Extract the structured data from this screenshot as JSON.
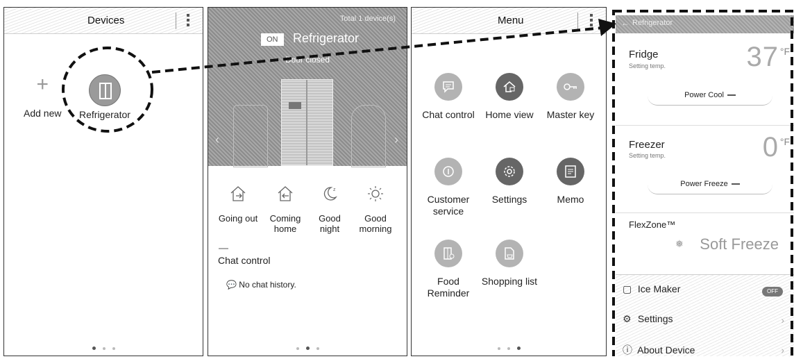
{
  "panel1": {
    "title": "Devices",
    "items": [
      {
        "label": "Add new",
        "icon": "plus-icon"
      },
      {
        "label": "Refrigerator",
        "icon": "refrigerator-icon"
      }
    ]
  },
  "panel2": {
    "total": "Total 1 device(s)",
    "power": "ON",
    "title": "Refrigerator",
    "subtitle": "Door closed",
    "modes": [
      {
        "label": "Going out",
        "icon": "home-leave-icon"
      },
      {
        "label": "Coming home",
        "icon": "home-arrive-icon"
      },
      {
        "label": "Good night",
        "icon": "moon-icon"
      },
      {
        "label": "Good morning",
        "icon": "sun-icon"
      }
    ],
    "chat_title": "Chat control",
    "chat_empty": "No chat history."
  },
  "panel3": {
    "title": "Menu",
    "items": [
      {
        "label": "Chat control",
        "icon": "chat-icon",
        "tone": "light"
      },
      {
        "label": "Home view",
        "icon": "home-camera-icon",
        "tone": "dark"
      },
      {
        "label": "Master key",
        "icon": "key-icon",
        "tone": "light"
      },
      {
        "label": "Customer service",
        "icon": "customer-service-icon",
        "tone": "light"
      },
      {
        "label": "Settings",
        "icon": "gear-icon",
        "tone": "dark"
      },
      {
        "label": "Memo",
        "icon": "memo-icon",
        "tone": "dark"
      },
      {
        "label": "Food Reminder",
        "icon": "food-reminder-icon",
        "tone": "light"
      },
      {
        "label": "Shopping list",
        "icon": "shopping-list-icon",
        "tone": "light"
      }
    ]
  },
  "panel4": {
    "title": "Refrigerator",
    "fridge": {
      "label": "Fridge",
      "sub": "Setting temp.",
      "temp": "37",
      "unit": "°F",
      "button": "Power Cool"
    },
    "freezer": {
      "label": "Freezer",
      "sub": "Setting temp.",
      "temp": "0",
      "unit": "°F",
      "button": "Power Freeze"
    },
    "flexzone": {
      "label": "FlexZone™",
      "mode": "Soft Freeze"
    },
    "ice_maker": {
      "label": "Ice Maker",
      "state": "OFF"
    },
    "settings": "Settings",
    "about": "About Device"
  }
}
